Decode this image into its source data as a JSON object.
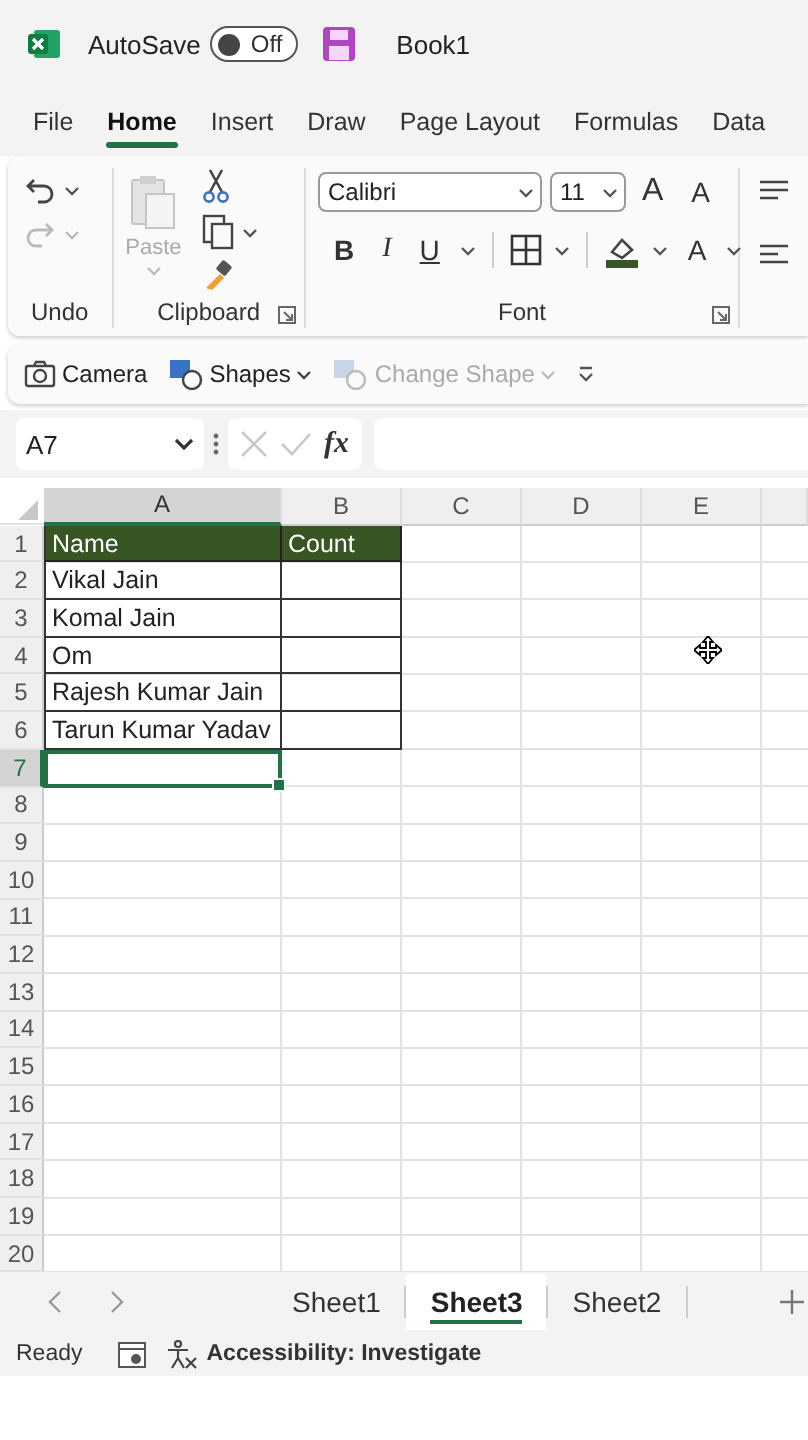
{
  "title_bar": {
    "autosave_label": "AutoSave",
    "autosave": {
      "on": false,
      "label": "Off"
    },
    "title": "Book1"
  },
  "menu_tabs": [
    {
      "label": "File",
      "selected": false
    },
    {
      "label": "Home",
      "selected": true
    },
    {
      "label": "Insert",
      "selected": false
    },
    {
      "label": "Draw",
      "selected": false
    },
    {
      "label": "Page Layout",
      "selected": false
    },
    {
      "label": "Formulas",
      "selected": false
    },
    {
      "label": "Data",
      "selected": false
    }
  ],
  "ribbon": {
    "undo_label": "Undo",
    "clipboard_label": "Clipboard",
    "paste_label": "Paste",
    "font_label": "Font",
    "font_name": "Calibri",
    "font_size": "11",
    "grow_font": "A",
    "shrink_font": "A",
    "bold": "B",
    "italic": "I",
    "underline": "U",
    "font_color": "A"
  },
  "quick_bar": [
    {
      "label": "Camera",
      "kind": "camera",
      "disabled": false,
      "dropdown": false
    },
    {
      "label": "Shapes",
      "kind": "shapes",
      "disabled": false,
      "dropdown": true
    },
    {
      "label": "Change Shape",
      "kind": "shapes",
      "disabled": true,
      "dropdown": true
    }
  ],
  "formula_bar": {
    "name_box": "A7",
    "function_label": "fx"
  },
  "grid": {
    "columns": [
      {
        "label": "A",
        "selected": true
      },
      {
        "label": "B",
        "selected": false
      },
      {
        "label": "C",
        "selected": false
      },
      {
        "label": "D",
        "selected": false
      },
      {
        "label": "E",
        "selected": false
      }
    ],
    "rows": [
      {
        "number": "1",
        "selected": false,
        "cells": [
          {
            "kind": "header",
            "text": "Name"
          },
          {
            "kind": "header",
            "text": "Count"
          }
        ]
      },
      {
        "number": "2",
        "selected": false,
        "cells": [
          {
            "kind": "data",
            "text": "Vikal Jain"
          },
          {
            "kind": "data"
          }
        ]
      },
      {
        "number": "3",
        "selected": false,
        "cells": [
          {
            "kind": "data",
            "text": "Komal Jain"
          },
          {
            "kind": "data"
          }
        ]
      },
      {
        "number": "4",
        "selected": false,
        "cells": [
          {
            "kind": "data",
            "text": "Om"
          },
          {
            "kind": "data"
          }
        ]
      },
      {
        "number": "5",
        "selected": false,
        "cells": [
          {
            "kind": "data",
            "text": "Rajesh Kumar Jain"
          },
          {
            "kind": "data"
          }
        ]
      },
      {
        "number": "6",
        "selected": false,
        "cells": [
          {
            "kind": "data",
            "text": "Tarun Kumar Yadav"
          },
          {
            "kind": "data"
          }
        ]
      },
      {
        "number": "7",
        "selected": true,
        "cells": [
          {
            "kind": "plain",
            "active": true
          }
        ]
      },
      {
        "number": "8",
        "selected": false
      },
      {
        "number": "9",
        "selected": false
      },
      {
        "number": "10",
        "selected": false
      },
      {
        "number": "11",
        "selected": false
      },
      {
        "number": "12",
        "selected": false
      },
      {
        "number": "13",
        "selected": false
      },
      {
        "number": "14",
        "selected": false
      },
      {
        "number": "15",
        "selected": false
      },
      {
        "number": "16",
        "selected": false
      },
      {
        "number": "17",
        "selected": false
      },
      {
        "number": "18",
        "selected": false
      },
      {
        "number": "19",
        "selected": false
      },
      {
        "number": "20",
        "selected": false
      }
    ]
  },
  "sheet_tabs": [
    {
      "label": "Sheet1",
      "selected": false
    },
    {
      "label": "Sheet3",
      "selected": true
    },
    {
      "label": "Sheet2",
      "selected": false
    }
  ],
  "status_bar": {
    "status": "Ready",
    "accessibility": "Accessibility: Investigate"
  }
}
